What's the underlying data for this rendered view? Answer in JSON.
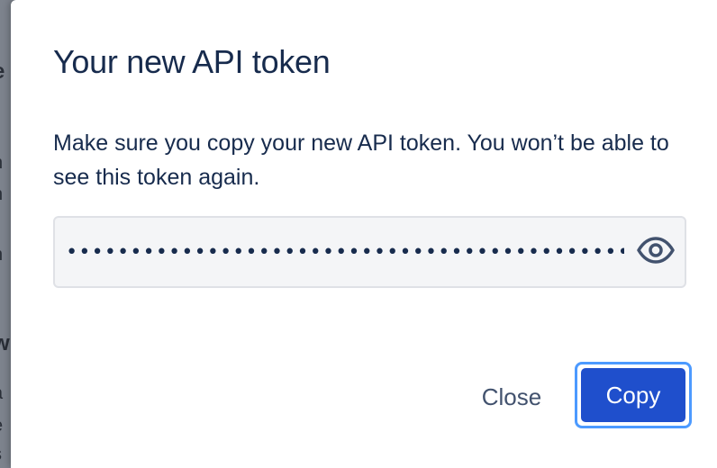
{
  "backdrop": {
    "fragments": [
      "e",
      "n",
      "n",
      "n",
      "w",
      "a",
      "e",
      "s"
    ]
  },
  "modal": {
    "title": "Your new API token",
    "description": "Make sure you copy your new API token. You won’t be able to see this token again.",
    "token_field": {
      "value": "••••••••••••••••••••••••••••••••••••••••••••••••••••",
      "masked": true,
      "reveal_icon": "eye-icon"
    },
    "buttons": {
      "close_label": "Close",
      "copy_label": "Copy"
    }
  },
  "colors": {
    "title_text": "#172b4d",
    "primary_button": "#1f4fcc",
    "focus_ring": "#4c9aff",
    "subtle_button_text": "#42526e",
    "field_background": "#f4f5f7"
  }
}
